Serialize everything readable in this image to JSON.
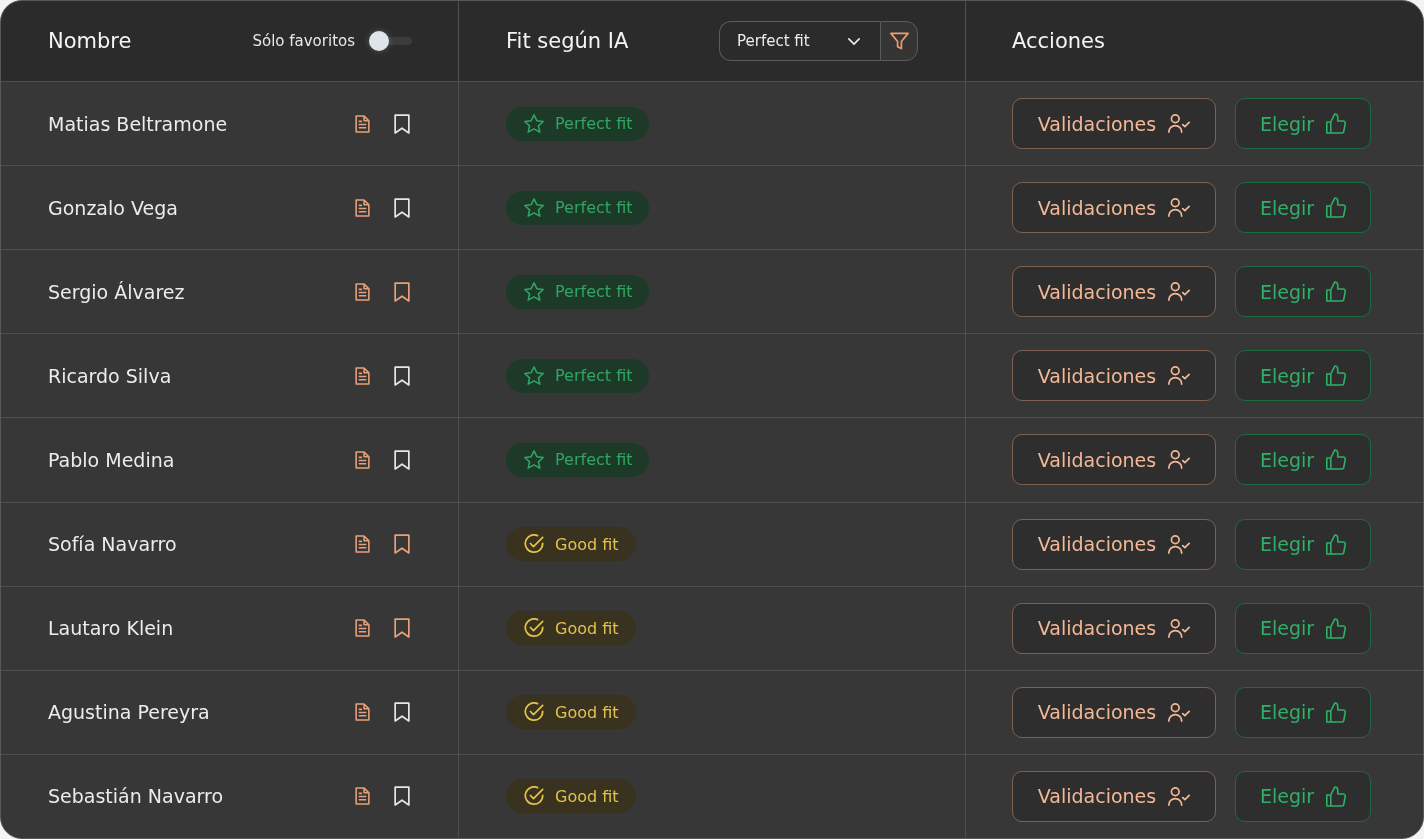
{
  "header": {
    "name_column": {
      "title": "Nombre",
      "favorites_toggle": {
        "label": "Sólo favoritos",
        "on": false
      }
    },
    "fit_column": {
      "title": "Fit según IA",
      "filter": {
        "value": "Perfect fit"
      }
    },
    "actions_column": {
      "title": "Acciones"
    }
  },
  "rows": [
    {
      "name": "Matias Beltramone",
      "bookmarked": false,
      "fit": {
        "kind": "perfect",
        "label": "Perfect fit"
      },
      "validate_label": "Validaciones",
      "choose_label": "Elegir"
    },
    {
      "name": "Gonzalo Vega",
      "bookmarked": false,
      "fit": {
        "kind": "perfect",
        "label": "Perfect fit"
      },
      "validate_label": "Validaciones",
      "choose_label": "Elegir"
    },
    {
      "name": "Sergio Álvarez",
      "bookmarked": true,
      "fit": {
        "kind": "perfect",
        "label": "Perfect fit"
      },
      "validate_label": "Validaciones",
      "choose_label": "Elegir"
    },
    {
      "name": "Ricardo Silva",
      "bookmarked": false,
      "fit": {
        "kind": "perfect",
        "label": "Perfect fit"
      },
      "validate_label": "Validaciones",
      "choose_label": "Elegir"
    },
    {
      "name": "Pablo Medina",
      "bookmarked": false,
      "fit": {
        "kind": "perfect",
        "label": "Perfect fit"
      },
      "validate_label": "Validaciones",
      "choose_label": "Elegir"
    },
    {
      "name": "Sofía Navarro",
      "bookmarked": true,
      "fit": {
        "kind": "good",
        "label": "Good fit"
      },
      "validate_label": "Validaciones",
      "choose_label": "Elegir"
    },
    {
      "name": "Lautaro Klein",
      "bookmarked": true,
      "fit": {
        "kind": "good",
        "label": "Good fit"
      },
      "validate_label": "Validaciones",
      "choose_label": "Elegir"
    },
    {
      "name": "Agustina Pereyra",
      "bookmarked": false,
      "fit": {
        "kind": "good",
        "label": "Good fit"
      },
      "validate_label": "Validaciones",
      "choose_label": "Elegir"
    },
    {
      "name": "Sebastián Navarro",
      "bookmarked": false,
      "fit": {
        "kind": "good",
        "label": "Good fit"
      },
      "validate_label": "Validaciones",
      "choose_label": "Elegir"
    }
  ]
}
